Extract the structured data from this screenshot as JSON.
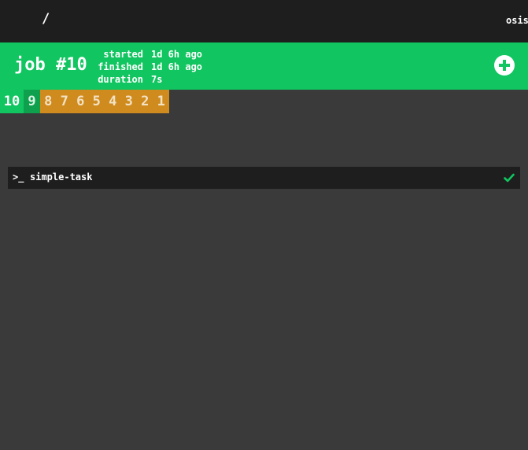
{
  "topbar": {
    "breadcrumb_separator": "/",
    "user_label": "osis"
  },
  "job": {
    "title": "job #10",
    "summary": [
      {
        "key": "started",
        "value": "1d 6h ago"
      },
      {
        "key": "finished",
        "value": "1d 6h ago"
      },
      {
        "key": "duration",
        "value": "7s"
      }
    ],
    "add_icon": "plus-circle-icon"
  },
  "builds": [
    {
      "label": "10",
      "status": "current"
    },
    {
      "label": "9",
      "status": "succeeded"
    },
    {
      "label": "8",
      "status": "pending"
    },
    {
      "label": "7",
      "status": "pending"
    },
    {
      "label": "6",
      "status": "pending"
    },
    {
      "label": "5",
      "status": "pending"
    },
    {
      "label": "4",
      "status": "pending"
    },
    {
      "label": "3",
      "status": "pending"
    },
    {
      "label": "2",
      "status": "pending"
    },
    {
      "label": "1",
      "status": "pending"
    }
  ],
  "task": {
    "prompt": ">_",
    "name": "simple-task",
    "status_icon": "checkmark-icon"
  },
  "colors": {
    "success": "#11c560",
    "success_dark": "#0fa04e",
    "pending": "#d08b1e",
    "background": "#3a3a3a",
    "bar": "#1e1e1e"
  }
}
